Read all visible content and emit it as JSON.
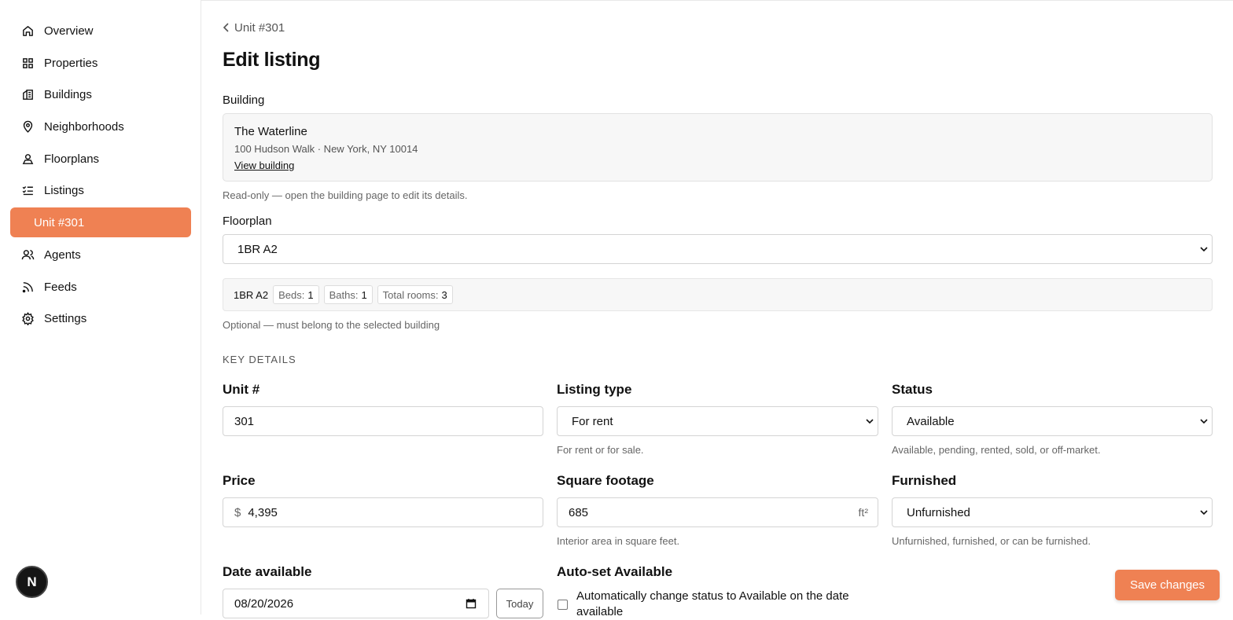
{
  "sidebar": {
    "items": [
      {
        "label": "Overview",
        "icon": "home-icon"
      },
      {
        "label": "Properties",
        "icon": "grid-icon"
      },
      {
        "label": "Buildings",
        "icon": "building-icon"
      },
      {
        "label": "Neighborhoods",
        "icon": "map-pin-icon"
      },
      {
        "label": "Floorplans",
        "icon": "floorplan-icon"
      },
      {
        "label": "Listings",
        "icon": "list-check-icon"
      },
      {
        "label": "Unit #301",
        "active": true
      },
      {
        "label": "Agents",
        "icon": "users-icon"
      },
      {
        "label": "Feeds",
        "icon": "rss-icon"
      },
      {
        "label": "Settings",
        "icon": "gear-icon"
      }
    ],
    "badge": "N"
  },
  "breadcrumb": "Unit #301",
  "page_title": "Edit listing",
  "building": {
    "label": "Building",
    "name": "The Waterline",
    "address": "100 Hudson Walk · New York, NY 10014",
    "link": "View building",
    "hint": "Read-only — open the building page to edit its details."
  },
  "floorplan": {
    "label": "Floorplan",
    "selected": "1BR A2",
    "summary_name": "1BR A2",
    "chips": [
      {
        "label": "Beds:",
        "value": "1"
      },
      {
        "label": "Baths:",
        "value": "1"
      },
      {
        "label": "Total rooms:",
        "value": "3"
      }
    ],
    "hint": "Optional — must belong to the selected building"
  },
  "key_details": {
    "section_title": "KEY DETAILS",
    "unit": {
      "label": "Unit #",
      "value": "301"
    },
    "listing_type": {
      "label": "Listing type",
      "value": "For rent",
      "hint": "For rent or for sale."
    },
    "status": {
      "label": "Status",
      "value": "Available",
      "hint": "Available, pending, rented, sold, or off-market."
    },
    "price": {
      "label": "Price",
      "prefix": "$",
      "value": "4,395"
    },
    "square_footage": {
      "label": "Square footage",
      "value": "685",
      "suffix": "ft²",
      "hint": "Interior area in square feet."
    },
    "furnished": {
      "label": "Furnished",
      "value": "Unfurnished",
      "hint": "Unfurnished, furnished, or can be furnished."
    },
    "date_available": {
      "label": "Date available",
      "value": "08/20/2026",
      "today_label": "Today"
    },
    "auto_set": {
      "label": "Auto-set Available",
      "checkbox_text": "Automatically change status to Available on the date available"
    }
  },
  "actions": {
    "save_label": "Save changes"
  },
  "colors": {
    "accent": "#ef8153"
  }
}
